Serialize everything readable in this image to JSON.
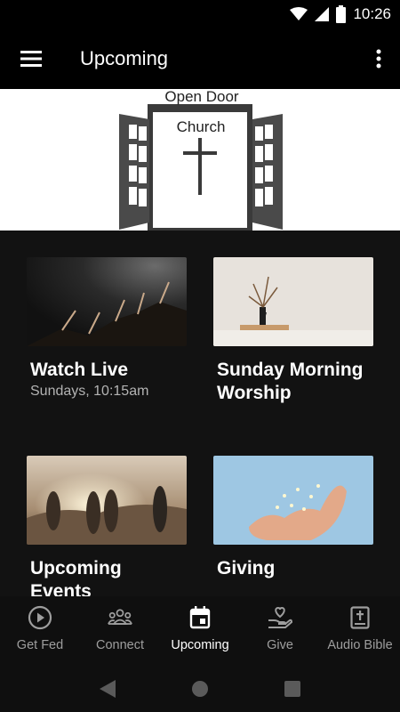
{
  "status_bar": {
    "time": "10:26"
  },
  "app_bar": {
    "title": "Upcoming",
    "menu_icon": "hamburger-menu-icon",
    "more_icon": "more-vert-icon"
  },
  "banner": {
    "line1": "Open Door",
    "line2": "Church"
  },
  "cards": [
    {
      "title": "Watch Live",
      "subtitle": "Sundays, 10:15am"
    },
    {
      "title": "Sunday Morning Worship",
      "subtitle": ""
    },
    {
      "title": "Upcoming Events",
      "subtitle": ""
    },
    {
      "title": "Giving",
      "subtitle": ""
    }
  ],
  "bottom_nav": {
    "items": [
      {
        "label": "Get Fed",
        "icon": "play-circle-icon"
      },
      {
        "label": "Connect",
        "icon": "groups-icon"
      },
      {
        "label": "Upcoming",
        "icon": "calendar-icon"
      },
      {
        "label": "Give",
        "icon": "hand-heart-icon"
      },
      {
        "label": "Audio Bible",
        "icon": "bible-icon"
      }
    ],
    "active": "Upcoming"
  },
  "colors": {
    "background": "#121212",
    "bar": "#000000",
    "nav": "#0f0f0f",
    "active": "#ffffff",
    "inactive": "#9e9e9e"
  }
}
